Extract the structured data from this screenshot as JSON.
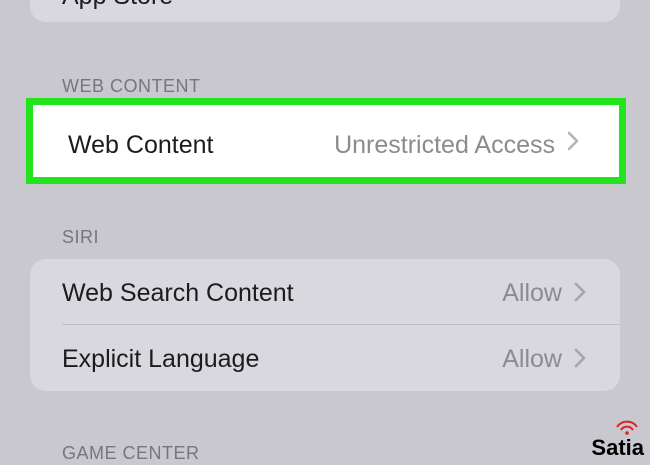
{
  "top_panel": {
    "partial_label": "App Store"
  },
  "web_content_section": {
    "header": "WEB CONTENT",
    "row": {
      "label": "Web Content",
      "value": "Unrestricted Access"
    }
  },
  "siri_section": {
    "header": "SIRI",
    "rows": [
      {
        "label": "Web Search Content",
        "value": "Allow"
      },
      {
        "label": "Explicit Language",
        "value": "Allow"
      }
    ]
  },
  "game_center_section": {
    "header": "GAME CENTER"
  },
  "watermark": {
    "text": "Satia"
  },
  "colors": {
    "highlight_border": "#21e41d",
    "background": "#c9c8ce",
    "cell": "#d9d8de"
  }
}
